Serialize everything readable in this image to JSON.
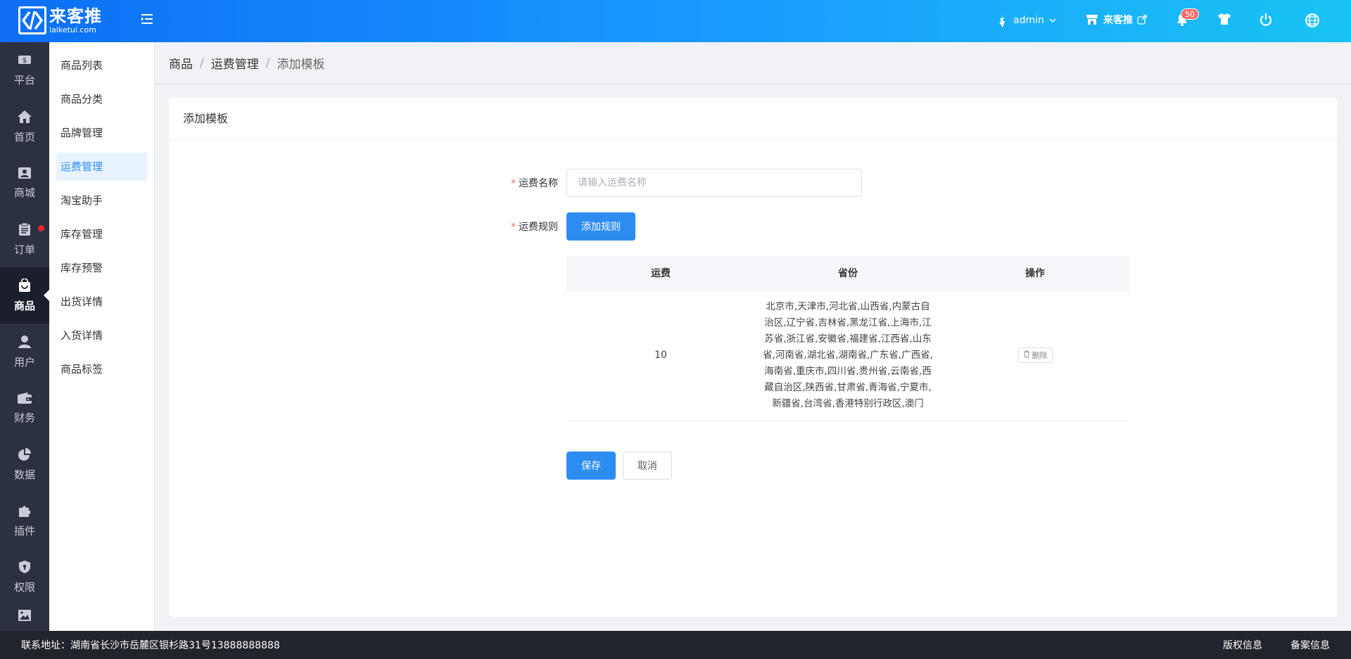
{
  "header": {
    "logo_cn": "来客推",
    "logo_en": "laiketui.com",
    "user_name": "admin",
    "store_name": "来客推",
    "notify_count": "50"
  },
  "rail": {
    "items": [
      {
        "label": "平台",
        "icon": "dollar-icon"
      },
      {
        "label": "首页",
        "icon": "home-icon"
      },
      {
        "label": "商城",
        "icon": "store-icon"
      },
      {
        "label": "订单",
        "icon": "clipboard-icon"
      },
      {
        "label": "商品",
        "icon": "bag-icon"
      },
      {
        "label": "用户",
        "icon": "user-icon"
      },
      {
        "label": "财务",
        "icon": "wallet-icon"
      },
      {
        "label": "数据",
        "icon": "pie-chart-icon"
      },
      {
        "label": "插件",
        "icon": "puzzle-icon"
      },
      {
        "label": "权限",
        "icon": "shield-icon"
      }
    ]
  },
  "submenu": {
    "items": [
      "商品列表",
      "商品分类",
      "品牌管理",
      "运费管理",
      "淘宝助手",
      "库存管理",
      "库存预警",
      "出货详情",
      "入货详情",
      "商品标签"
    ],
    "active_index": 3
  },
  "breadcrumb": [
    "商品",
    "运费管理",
    "添加模板"
  ],
  "card": {
    "title": "添加模板"
  },
  "form": {
    "name_label": "运费名称",
    "name_placeholder": "请输入运费名称",
    "name_value": "",
    "rule_label": "运费规则",
    "add_rule_button": "添加规则",
    "save_button": "保存",
    "cancel_button": "取消"
  },
  "rules_table": {
    "headers": [
      "运费",
      "省份",
      "操作"
    ],
    "rows": [
      {
        "fee": "10",
        "provinces": "北京市,天津市,河北省,山西省,内蒙古自治区,辽宁省,吉林省,黑龙江省,上海市,江苏省,浙江省,安徽省,福建省,江西省,山东省,河南省,湖北省,湖南省,广东省,广西省,海南省,重庆市,四川省,贵州省,云南省,西藏自治区,陕西省,甘肃省,青海省,宁夏市,新疆省,台湾省,香港特别行政区,澳门",
        "delete_label": "删除"
      }
    ]
  },
  "footer": {
    "address": "联系地址：湖南省长沙市岳麓区银杉路31号13888888888",
    "copyright": "版权信息",
    "record": "备案信息"
  },
  "colors": {
    "primary": "#2d8cf0",
    "header_start": "#0d6ef5",
    "header_end": "#19c3f3",
    "rail_bg": "#2c3140",
    "footer_bg": "#22242c",
    "badge": "#f56c6c"
  }
}
